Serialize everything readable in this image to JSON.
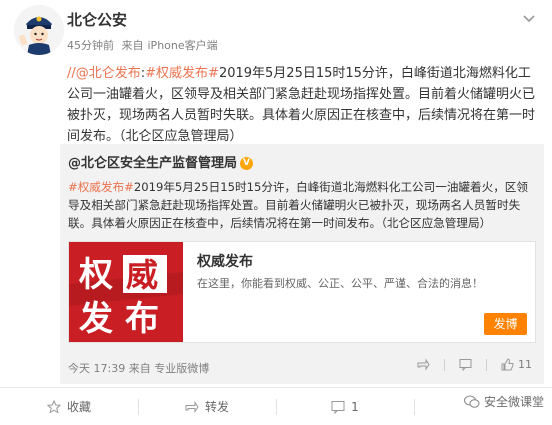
{
  "post": {
    "author": "北仑公安",
    "time": "45分钟前",
    "source_prefix": "来自",
    "source": "iPhone客户端",
    "body_link_user": "//@北仑发布",
    "body_colon": ":",
    "body_topic": "#权威发布#",
    "body_text": "2019年5月25日15时15分许，白峰街道北海燃料化工公司一油罐着火，区领导及相关部门紧急赶赴现场指挥处置。目前着火储罐明火已被扑灭，现场两名人员暂时失联。具体着火原因正在核查中，后续情况将在第一时间发布。（北仑区应急管理局）"
  },
  "repost": {
    "author": "@北仑区安全生产监督管理局",
    "vbadge": "V",
    "topic": "#权威发布#",
    "text": "2019年5月25日15时15分许，白峰街道北海燃料化工公司一油罐着火，区领导及相关部门紧急赶赴现场指挥处置。目前着火储罐明火已被扑灭，现场两名人员暂时失联。具体着火原因正在核查中，后续情况将在第一时间发布。（北仑区应急管理局）",
    "card": {
      "cover_line1_a": "权",
      "cover_line1_b": "威",
      "cover_line2_a": "发",
      "cover_line2_b": "布",
      "title": "权威发布",
      "description": "在这里，你能看到权威、公正、公平、严谨、合法的消息！",
      "button": "发博"
    },
    "footer_time": "今天 17:39 来自 专业版微博",
    "like_count": "11"
  },
  "actions": {
    "collect": "收藏",
    "forward": "转发",
    "comment": "1"
  },
  "watermark": "安全微课堂",
  "colors": {
    "accent": "#eb7350",
    "cover_red": "#c91f24",
    "button_orange": "#ff8200"
  }
}
